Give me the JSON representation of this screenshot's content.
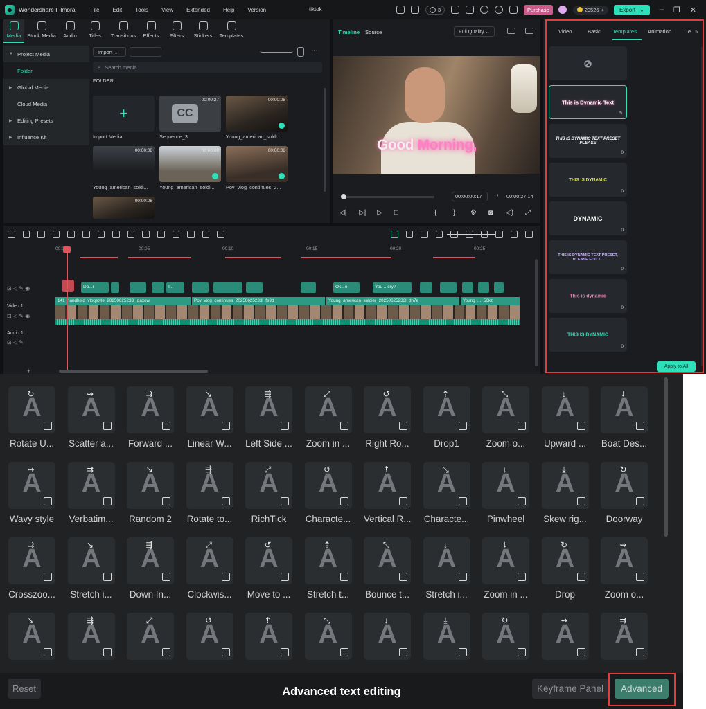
{
  "titlebar": {
    "app_name": "Wondershare Filmora",
    "menu": [
      "File",
      "Edit",
      "Tools",
      "View",
      "Extended",
      "Help",
      "Version"
    ],
    "project_name": "tiktok",
    "badge_count": "3",
    "purchase": "Purchase",
    "coins": "29526",
    "export": "Export"
  },
  "media_tabs": [
    "Media",
    "Stock Media",
    "Audio",
    "Titles",
    "Transitions",
    "Effects",
    "Filters",
    "Stickers",
    "Templates"
  ],
  "media_sidebar": {
    "items": [
      "Project Media",
      "Folder",
      "Global Media",
      "Cloud Media",
      "Editing Presets",
      "Influence Kit"
    ]
  },
  "media": {
    "import_label": "Import",
    "search_placeholder": "Search media",
    "folder_label": "FOLDER",
    "items": [
      {
        "caption": "Import Media",
        "duration": ""
      },
      {
        "caption": "Sequence_3",
        "duration": "00:00:27"
      },
      {
        "caption": "Young_american_soldi...",
        "duration": "00:00:08"
      },
      {
        "caption": "Young_american_soldi...",
        "duration": "00:00:08"
      },
      {
        "caption": "Young_american_soldi...",
        "duration": "00:00:08"
      },
      {
        "caption": "Pov_vlog_continues_2...",
        "duration": "00:00:08"
      },
      {
        "caption": "",
        "duration": "00:00:08"
      }
    ]
  },
  "player": {
    "tab_timeline": "Timeline",
    "tab_source": "Source",
    "quality": "Full Quality",
    "caption_word1": "Good",
    "caption_word2": "Morning,",
    "current_time": "00:00:00:17",
    "separator": "/",
    "total_time": "00:00:27:14"
  },
  "timeline": {
    "ruler": [
      "00:00",
      "00:05",
      "00:10",
      "00:15",
      "00:20",
      "00:25"
    ],
    "video_track_label": "Video 1",
    "audio_track_label": "Audio 1",
    "text_clips": [
      "Da...r",
      "I...",
      "Ok...o.",
      "You ...cry?"
    ],
    "video_clips": [
      "141_handheld_vlogstyle_20250625233l_gaxow",
      "Pov_vlog_continues_20250625233l_fe9d",
      "Young_american_soldier_20250625233l_dn7e",
      "Young_..._56kz"
    ]
  },
  "properties": {
    "tabs": [
      "Video",
      "Basic",
      "Templates",
      "Animation",
      "Te"
    ],
    "active_tab": "Templates",
    "templates": [
      {
        "label": "",
        "count": ""
      },
      {
        "label": "This is Dynamic Text",
        "count": ""
      },
      {
        "label": "THIS IS DYNAMIC TEXT PRESET PLEASE",
        "count": "0"
      },
      {
        "label": "THIS IS DYNAMIC",
        "count": "0"
      },
      {
        "label": "DYNAMIC",
        "count": "0"
      },
      {
        "label": "THIS IS DYNAMIC TEXT PRESET, PLEASE EDIT IT.",
        "count": "0"
      },
      {
        "label": "This is dynamic",
        "count": "0"
      },
      {
        "label": "THIS IS DYNAMIC",
        "count": "0"
      }
    ],
    "apply_all": "Apply to All"
  },
  "effects": {
    "rows": [
      [
        "Rotate U...",
        "Scatter a...",
        "Forward ...",
        "Linear W...",
        "Left Side ...",
        "Zoom in ...",
        "Right Ro...",
        "Drop1",
        "Zoom o...",
        "Upward ...",
        "Boat Des..."
      ],
      [
        "Wavy style",
        "Verbatim...",
        "Random 2",
        "Rotate to...",
        "RichTick",
        "Characte...",
        "Vertical R...",
        "Characte...",
        "Pinwheel",
        "Skew rig...",
        "Doorway"
      ],
      [
        "Crosszoo...",
        "Stretch i...",
        "Down In...",
        "Clockwis...",
        "Move to ...",
        "Stretch t...",
        "Bounce t...",
        "Stretch i...",
        "Zoom in ...",
        "Drop",
        "Zoom o..."
      ],
      [
        "",
        "",
        "",
        "",
        "",
        "",
        "",
        "",
        "",
        "",
        ""
      ]
    ],
    "reset": "Reset",
    "title": "Advanced text editing",
    "keyframe_panel": "Keyframe Panel",
    "advanced": "Advanced"
  },
  "colors": {
    "accent": "#2ee0b9",
    "highlight_box": "#e53b3b",
    "purchase": "#c85c8a"
  }
}
